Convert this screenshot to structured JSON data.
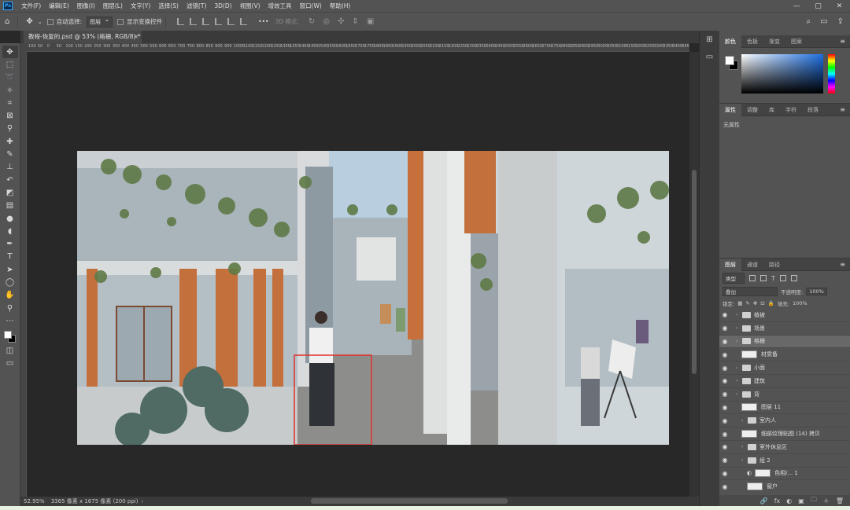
{
  "menu": {
    "app_icon": "Ps",
    "items": [
      "文件(F)",
      "编辑(E)",
      "图像(I)",
      "图层(L)",
      "文字(Y)",
      "选择(S)",
      "滤镜(T)",
      "3D(D)",
      "视图(V)",
      "增效工具",
      "窗口(W)",
      "帮助(H)"
    ],
    "window_controls": [
      "—",
      "▢",
      "✕"
    ]
  },
  "options": {
    "auto_select_label": "自动选择:",
    "auto_select_value": "图层",
    "transform_label": "显示变换控件",
    "more": "•••",
    "mode_3d_label": "3D 模式:"
  },
  "document": {
    "tab_title": "教程-恢复的.psd @ 53% (格栅, RGB/8) *",
    "close": "×",
    "ruler_ticks": [
      "100",
      "50",
      "0",
      "50",
      "100",
      "150",
      "200",
      "250",
      "300",
      "350",
      "400",
      "450",
      "500",
      "550",
      "600",
      "650",
      "700",
      "750",
      "800",
      "850",
      "900",
      "950",
      "1000",
      "1100",
      "1150",
      "1200",
      "1250",
      "1300",
      "1350",
      "1400",
      "1450",
      "1500",
      "1550",
      "1600",
      "1650",
      "1700",
      "1750",
      "1800",
      "1850",
      "1900",
      "1950",
      "2000",
      "2050",
      "2100",
      "2150",
      "2200",
      "2250",
      "2300",
      "2350",
      "2400",
      "2450",
      "2500",
      "2550",
      "2600",
      "2650",
      "2700",
      "2750",
      "2800",
      "2850",
      "2900",
      "2950",
      "3000",
      "3050",
      "3100",
      "3150",
      "3200",
      "3250",
      "3300",
      "3350",
      "3400",
      "3450"
    ]
  },
  "status": {
    "zoom": "52.95%",
    "doc_info": "3365 像素 x 1675 像素 (200 ppi)",
    "arrow": "›"
  },
  "panels": {
    "color_tabs": [
      "颜色",
      "色板",
      "渐变",
      "图案"
    ],
    "props_tabs": [
      "属性",
      "调整",
      "库",
      "字符",
      "段落"
    ],
    "props_empty": "无属性",
    "layers_tabs": [
      "图层",
      "通道",
      "路径"
    ],
    "layer_kind": "类型",
    "blend_mode": "叠加",
    "opacity_label": "不透明度:",
    "opacity_value": "100%",
    "lock_label": "锁定:",
    "fill_label": "填充:",
    "fill_value": "100%",
    "layers": [
      {
        "name": "植被",
        "type": "folder",
        "indent": 1
      },
      {
        "name": "场景",
        "type": "folder",
        "indent": 1
      },
      {
        "name": "格栅",
        "type": "folder",
        "indent": 1,
        "selected": true
      },
      {
        "name": "材质备",
        "type": "layer",
        "indent": 2
      },
      {
        "name": "小面",
        "type": "folder",
        "indent": 1
      },
      {
        "name": "建筑",
        "type": "folder",
        "indent": 1
      },
      {
        "name": "背",
        "type": "folder",
        "indent": 1
      },
      {
        "name": "图层 11",
        "type": "layer",
        "indent": 2
      },
      {
        "name": "室内人",
        "type": "folder",
        "indent": 2
      },
      {
        "name": "细部纹理贴图 (14) 拷贝",
        "type": "layer",
        "indent": 2
      },
      {
        "name": "室外休息区",
        "type": "folder",
        "indent": 2
      },
      {
        "name": "组 2",
        "type": "folder",
        "indent": 2
      },
      {
        "name": "色相/... 1",
        "type": "adjustment",
        "indent": 3
      },
      {
        "name": "窗户",
        "type": "layer",
        "indent": 3
      }
    ],
    "footer_icons": [
      "🔗",
      "fx",
      "◐",
      "▣",
      "🗀",
      "＋",
      "🗑"
    ]
  }
}
